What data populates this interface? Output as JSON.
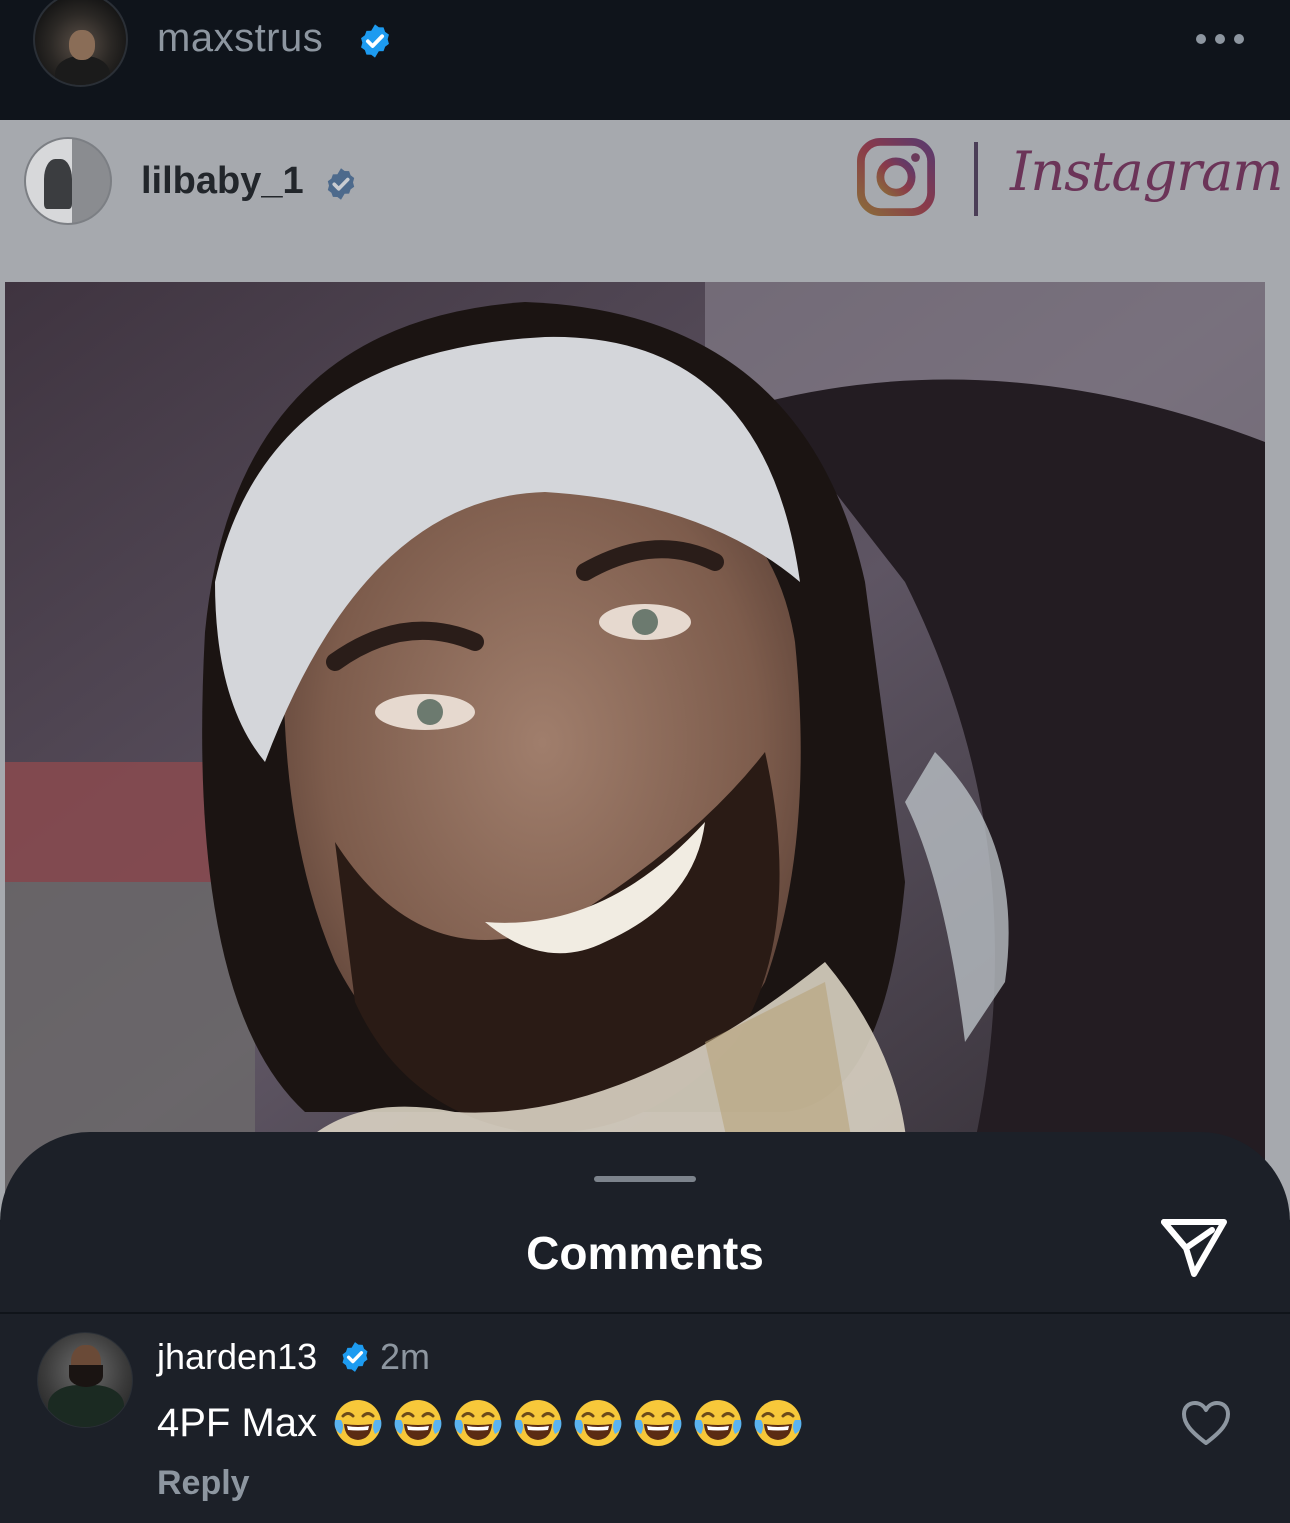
{
  "post_header": {
    "username": "maxstrus",
    "avatar": "profile-photo",
    "verified": true,
    "more_icon": "more-horizontal-icon"
  },
  "embedded_post": {
    "username": "lilbaby_1",
    "verified": true,
    "instagram_logo": "instagram-logo-icon",
    "photo": "selfie-smiling-man-white-headband"
  },
  "comments_sheet": {
    "title": "Comments",
    "share_icon": "send-icon",
    "comments": [
      {
        "username": "jharden13",
        "verified": true,
        "time": "2m",
        "text": "4PF Max",
        "emoji": "face-with-tears-of-joy",
        "emoji_count": 8,
        "reply_label": "Reply",
        "like_icon": "heart-outline-icon"
      }
    ]
  },
  "colors": {
    "background": "#0f141b",
    "sheet": "#1c2028",
    "verified_blue": "#1d9bf0",
    "muted_text": "#8d96a0",
    "instagram_accent": "#6b3458"
  }
}
